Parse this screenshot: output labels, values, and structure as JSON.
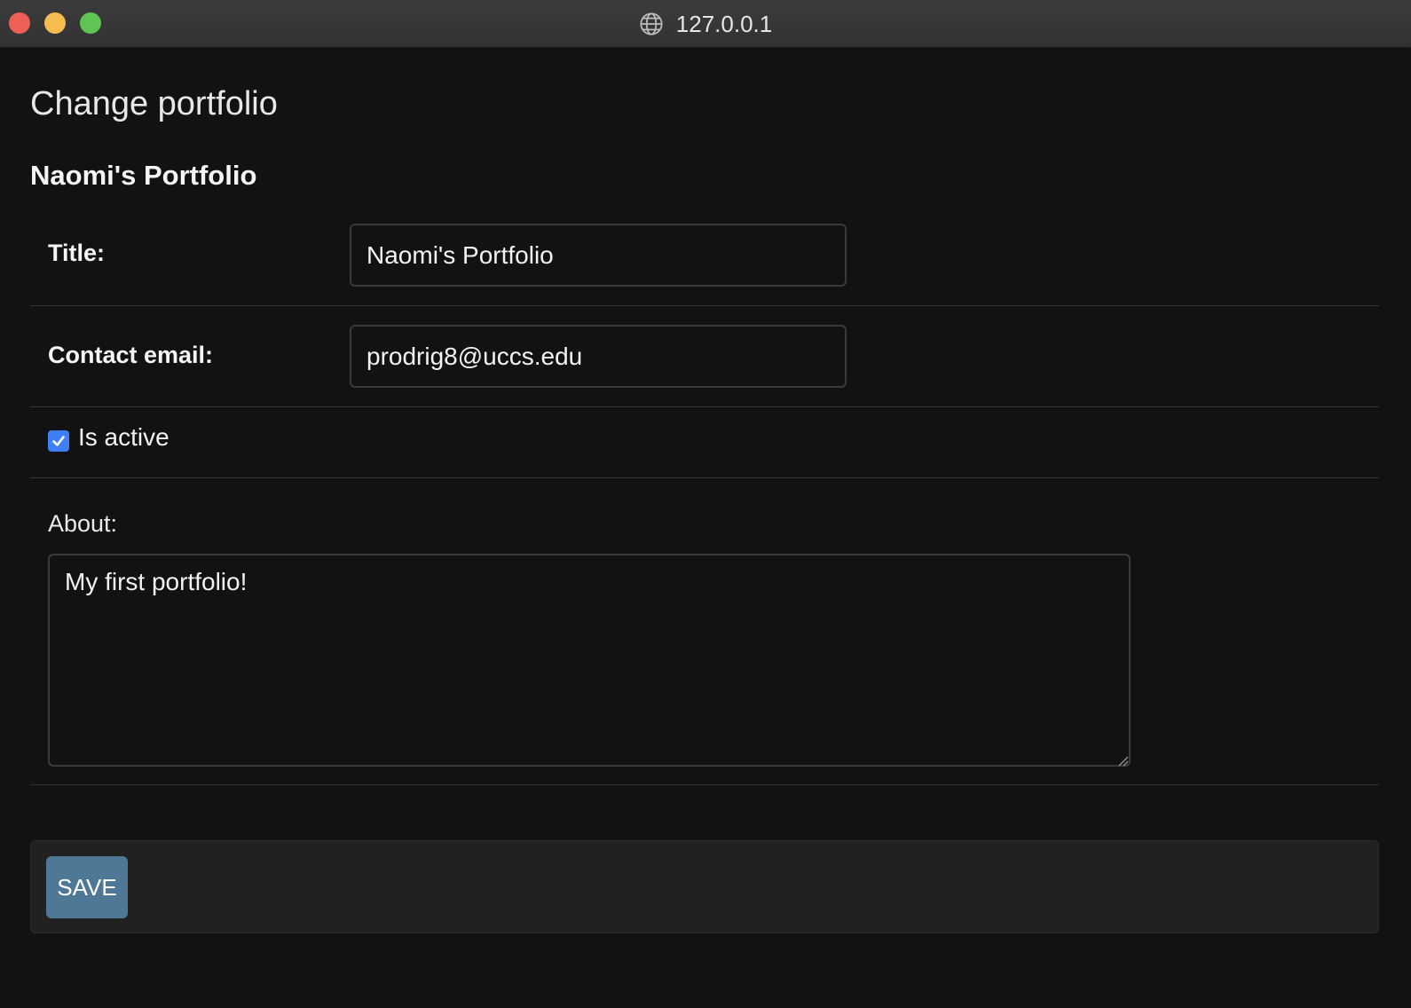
{
  "window": {
    "address": "127.0.0.1",
    "address_icon": "globe-icon"
  },
  "page": {
    "title": "Change portfolio",
    "heading": "Naomi's Portfolio"
  },
  "form": {
    "title_field": {
      "label": "Title:",
      "value": "Naomi's Portfolio"
    },
    "email_field": {
      "label": "Contact email:",
      "value": "prodrig8@uccs.edu"
    },
    "is_active": {
      "label": "Is active",
      "checked": true
    },
    "about_field": {
      "label": "About:",
      "value": "My first portfolio!"
    },
    "save_label": "SAVE"
  },
  "colors": {
    "background": "#121212",
    "save_button": "#4f7896",
    "checkbox": "#3f7ef5"
  }
}
